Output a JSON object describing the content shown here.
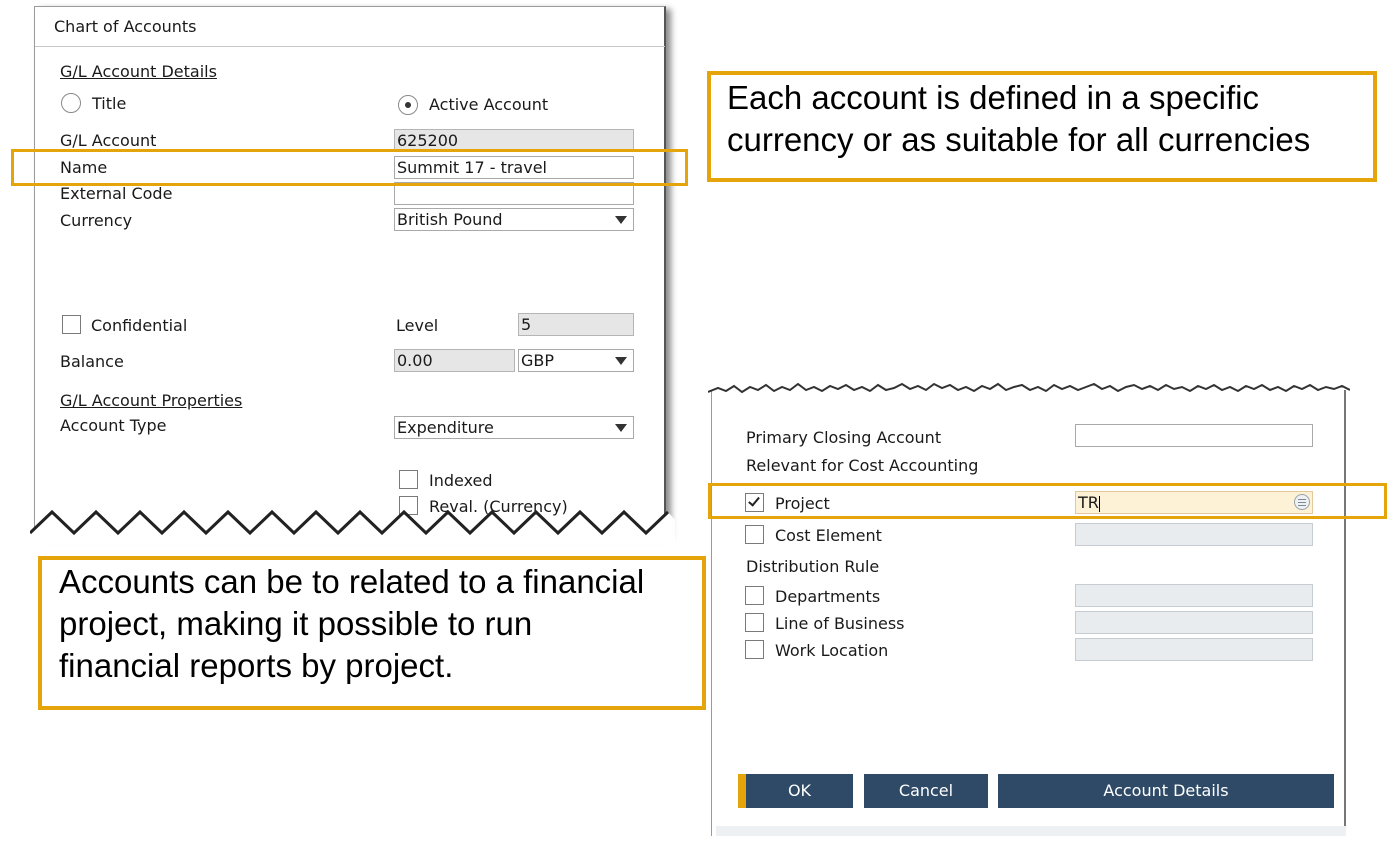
{
  "dialog": {
    "title": "Chart of Accounts",
    "section_details": "G/L Account Details",
    "radio_title": "Title",
    "radio_active": "Active Account",
    "gl_account_label": "G/L Account",
    "gl_account_value": "625200",
    "name_label": "Name",
    "name_value": "Summit 17 - travel",
    "external_code_label": "External Code",
    "external_code_value": "",
    "currency_label": "Currency",
    "currency_value": "British Pound",
    "confidential_label": "Confidential",
    "level_label": "Level",
    "level_value": "5",
    "balance_label": "Balance",
    "balance_value": "0.00",
    "balance_currency": "GBP",
    "section_properties": "G/L Account Properties",
    "account_type_label": "Account Type",
    "account_type_value": "Expenditure",
    "indexed_label": "Indexed",
    "reval_label": "Reval. (Currency)"
  },
  "panel": {
    "primary_closing_label": "Primary Closing Account",
    "primary_closing_value": "",
    "cost_accounting_label": "Relevant for Cost Accounting",
    "project_label": "Project",
    "project_checked": true,
    "project_value": "TR",
    "cost_element_label": "Cost Element",
    "distribution_rule_label": "Distribution Rule",
    "departments_label": "Departments",
    "line_of_business_label": "Line of Business",
    "work_location_label": "Work Location",
    "ok_label": "OK",
    "cancel_label": "Cancel",
    "account_details_label": "Account Details"
  },
  "callouts": {
    "currency_line1": "Each account is defined in a specific",
    "currency_line2": "currency or as suitable for all currencies",
    "project_line1": "Accounts can be to related to a financial",
    "project_line2": "project, making it possible to run",
    "project_line3": "financial reports by project."
  },
  "colors": {
    "highlight": "#e5a50a",
    "button": "#2e4a66",
    "ok_accent": "#e5a50a"
  }
}
